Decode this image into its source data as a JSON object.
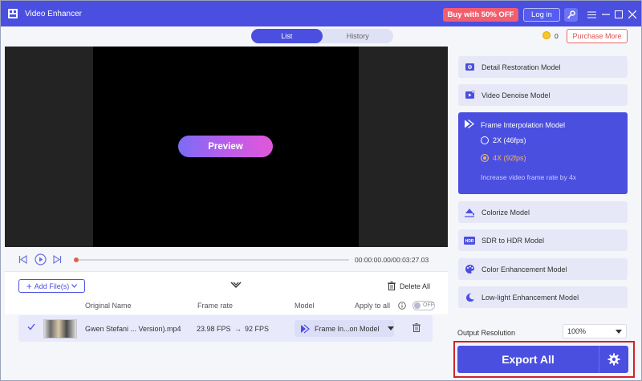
{
  "titlebar": {
    "title": "Video Enhancer",
    "buy_label": "Buy with 50% OFF",
    "login_label": "Log in"
  },
  "tabs": [
    {
      "label": "List",
      "active": true
    },
    {
      "label": "History",
      "active": false
    }
  ],
  "coins": "0",
  "purchase_label": "Purchase More",
  "preview": {
    "button_label": "Preview"
  },
  "playback": {
    "timecode": "00:00:00.00/00:03:27.03",
    "progress": 0
  },
  "toolbar": {
    "add_files_label": "Add File(s)",
    "delete_all_label": "Delete All"
  },
  "table": {
    "headers": {
      "original_name": "Original Name",
      "frame_rate": "Frame rate",
      "model": "Model",
      "apply_to_all": "Apply to all",
      "toggle_state": "OFF"
    },
    "rows": [
      {
        "name": "Gwen Stefani ... Version).mp4",
        "fps_from": "23.98 FPS",
        "arrow": "→",
        "fps_to": "92 FPS",
        "model": "Frame In...on Model"
      }
    ]
  },
  "models": {
    "detail": "Detail Restoration Model",
    "denoise": "Video Denoise Model",
    "interp": {
      "label": "Frame Interpolation Model",
      "options": [
        {
          "label": "2X (46fps)",
          "selected": false
        },
        {
          "label": "4X (92fps)",
          "selected": true
        }
      ],
      "description": "Increase video frame rate by 4x"
    },
    "colorize": "Colorize Model",
    "sdr_hdr": "SDR to HDR Model",
    "color_enh": "Color Enhancement Model",
    "lowlight": "Low-light Enhancement Model"
  },
  "output": {
    "label": "Output Resolution",
    "value": "100%"
  },
  "export": {
    "label": "Export All"
  },
  "colors": {
    "accent": "#4a4fe0",
    "buy": "#f35e6f",
    "highlight_border": "#d0232a"
  }
}
